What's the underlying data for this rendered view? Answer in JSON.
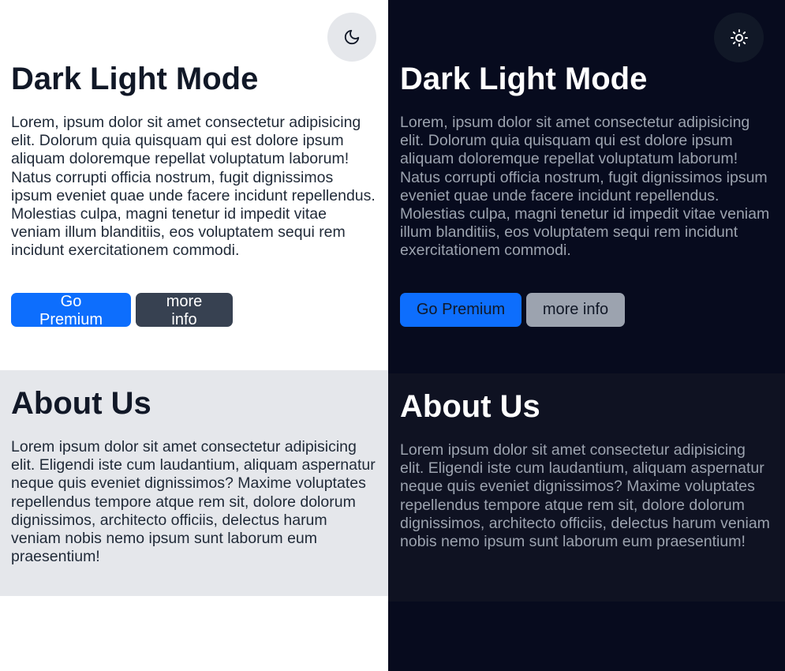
{
  "panels": {
    "light": {
      "toggle_icon": "moon-icon",
      "title": "Dark Light Mode",
      "intro": "Lorem, ipsum dolor sit amet consectetur adipisicing elit. Dolorum quia quisquam qui est dolore ipsum aliquam doloremque repellat voluptatum laborum! Natus corrupti officia nostrum, fugit dignissimos ipsum eveniet quae unde facere incidunt repellendus. Molestias culpa, magni tenetur id impedit vitae veniam illum blanditiis, eos voluptatem sequi rem incidunt exercitationem commodi.",
      "premium_label": "Go Premium",
      "info_label": "more info",
      "about_title": "About Us",
      "about_text": "Lorem ipsum dolor sit amet consectetur adipisicing elit. Eligendi iste cum laudantium, aliquam aspernatur neque quis eveniet dignissimos? Maxime voluptates repellendus tempore atque rem sit, dolore dolorum dignissimos, architecto officiis, delectus harum veniam nobis nemo ipsum sunt laborum eum praesentium!"
    },
    "dark": {
      "toggle_icon": "sun-icon",
      "title": "Dark Light Mode",
      "intro": "Lorem, ipsum dolor sit amet consectetur adipisicing elit. Dolorum quia quisquam qui est dolore ipsum aliquam doloremque repellat voluptatum laborum! Natus corrupti officia nostrum, fugit dignissimos ipsum eveniet quae unde facere incidunt repellendus. Molestias culpa, magni tenetur id impedit vitae veniam illum blanditiis, eos voluptatem sequi rem incidunt exercitationem commodi.",
      "premium_label": "Go Premium",
      "info_label": "more info",
      "about_title": "About Us",
      "about_text": "Lorem ipsum dolor sit amet consectetur adipisicing elit. Eligendi iste cum laudantium, aliquam aspernatur neque quis eveniet dignissimos? Maxime voluptates repellendus tempore atque rem sit, dolore dolorum dignissimos, architecto officiis, delectus harum veniam nobis nemo ipsum sunt laborum eum praesentium!"
    }
  },
  "colors": {
    "accent": "#0d6efd",
    "light_bg": "#ffffff",
    "light_section_bg": "#e5e7eb",
    "dark_bg": "#070b1e",
    "dark_section_bg": "#0f1222"
  }
}
